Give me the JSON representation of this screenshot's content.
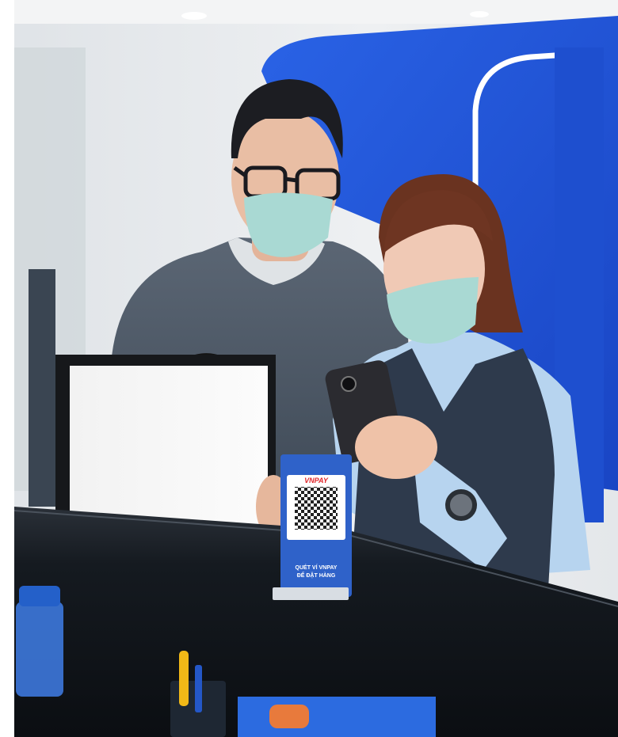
{
  "photo": {
    "qr_stand": {
      "brand": "VNPAY",
      "slogan_line1": "QUÉT VÍ VNPAY",
      "slogan_line2": "ĐỂ ĐẶT HÀNG"
    }
  },
  "colors": {
    "wall_blue": "#1f56d8",
    "wall_white": "#e9ecef",
    "counter": "#151a20",
    "stand_blue": "#2f62c9",
    "mask": "#a9d9d3",
    "sweater": "#4d5967",
    "vest": "#2e3a4c",
    "shirt": "#b7d4ef"
  }
}
